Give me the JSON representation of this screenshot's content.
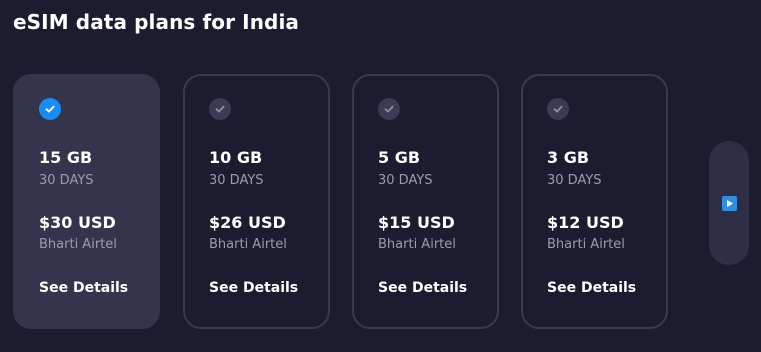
{
  "page": {
    "title": "eSIM data plans for India"
  },
  "plans": [
    {
      "data": "15 GB",
      "duration": "30 DAYS",
      "price": "$30 USD",
      "carrier": "Bharti Airtel",
      "details_label": "See Details",
      "selected": true
    },
    {
      "data": "10 GB",
      "duration": "30 DAYS",
      "price": "$26 USD",
      "carrier": "Bharti Airtel",
      "details_label": "See Details",
      "selected": false
    },
    {
      "data": "5 GB",
      "duration": "30 DAYS",
      "price": "$15 USD",
      "carrier": "Bharti Airtel",
      "details_label": "See Details",
      "selected": false
    },
    {
      "data": "3 GB",
      "duration": "30 DAYS",
      "price": "$12 USD",
      "carrier": "Bharti Airtel",
      "details_label": "See Details",
      "selected": false
    }
  ],
  "carousel": {
    "next_icon": "play-arrow-icon"
  },
  "colors": {
    "background": "#1c1c30",
    "selected_card": "#34344c",
    "card_border": "#393a52",
    "accent": "#1a8cf0",
    "muted_text": "#9a9cb0"
  }
}
